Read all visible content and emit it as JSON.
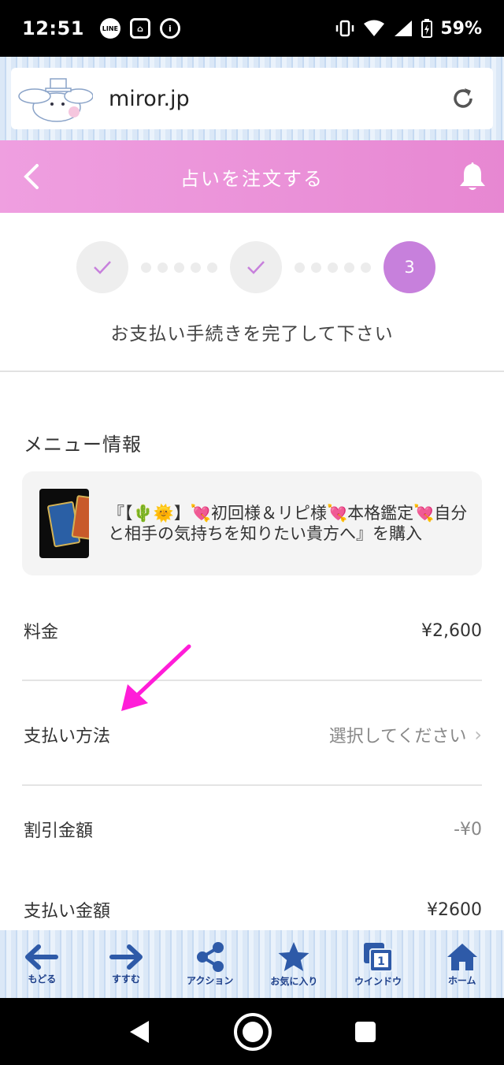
{
  "status_bar": {
    "time": "12:51",
    "battery": "59%"
  },
  "browser": {
    "url": "miror.jp"
  },
  "header": {
    "title": "占いを注文する"
  },
  "steps": {
    "current_step": "3",
    "caption": "お支払い手続きを完了して下さい"
  },
  "menu": {
    "section_title": "メニュー情報",
    "item_text": "『【🌵🌞】💘初回様＆リピ様💘本格鑑定💘自分と相手の気持ちを知りたい貴方へ』を購入"
  },
  "rows": {
    "price_label": "料金",
    "price_value": "¥2,600",
    "payment_method_label": "支払い方法",
    "payment_method_value": "選択してください",
    "discount_label": "割引金額",
    "discount_value": "-¥0",
    "total_label": "支払い金額",
    "total_value": "¥2600"
  },
  "toolbar": {
    "back": "もどる",
    "forward": "すすむ",
    "action": "アクション",
    "favorites": "お気に入り",
    "window": "ウインドウ",
    "window_count": "1",
    "home": "ホーム"
  },
  "colors": {
    "header_pink": "#e787d2",
    "step_active": "#c780dc",
    "toolbar_blue": "#2e5aa8",
    "annotation_arrow": "#ff1dd8"
  }
}
